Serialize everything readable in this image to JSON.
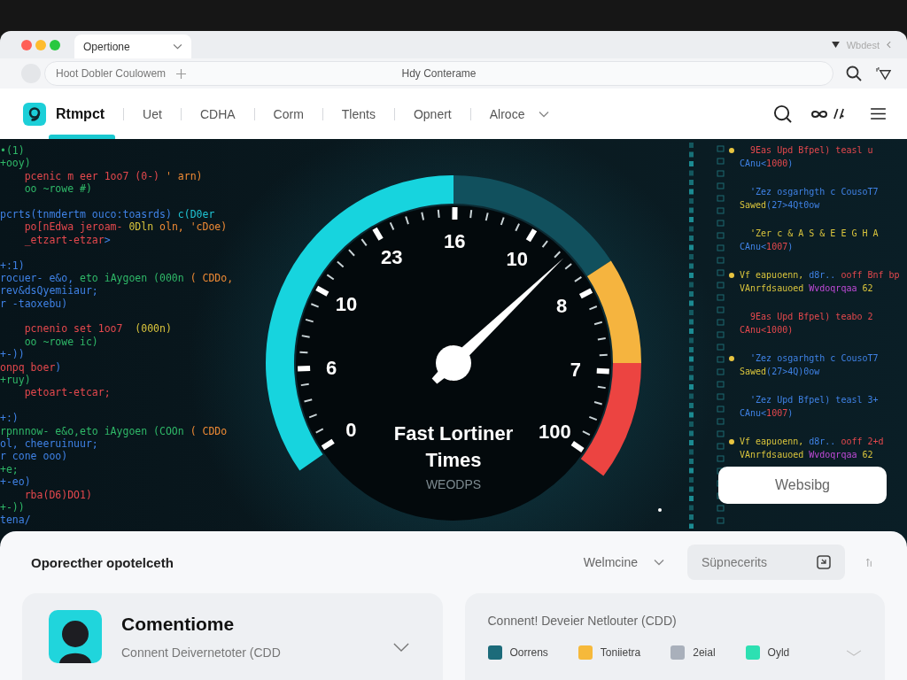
{
  "browser": {
    "tab": {
      "label": "Opertione",
      "selected": true
    },
    "tray_text": "Wbdest",
    "address_text": "Hoot Dobler Coulowem",
    "page_title": "Hdy Conterame"
  },
  "site_nav": {
    "brand": {
      "name": "Rtmpct",
      "active": true
    },
    "items": [
      {
        "label": "Uet",
        "kind": "link"
      },
      {
        "label": "CDHA",
        "kind": "link"
      },
      {
        "label": "Corm",
        "kind": "link"
      },
      {
        "label": "Tlents",
        "kind": "link"
      },
      {
        "label": "Opnert",
        "kind": "link"
      },
      {
        "label": "Alroce",
        "kind": "dropdown"
      }
    ]
  },
  "hero": {
    "left_code": [
      {
        "lines": [
          {
            "segments": [
              {
                "text": "•(1)",
                "kind": "string"
              }
            ]
          },
          {
            "segments": [
              {
                "text": "+ooy)",
                "kind": "string"
              }
            ]
          },
          {
            "segments": [
              {
                "text": "    pcenic m eer 1oo7 (0-)",
                "kind": "keyword"
              },
              {
                "text": " ' arn)",
                "kind": "operator"
              }
            ]
          },
          {
            "segments": [
              {
                "text": "    oo ~rowe #)",
                "kind": "string"
              }
            ]
          }
        ]
      },
      {
        "lines": [
          {
            "segments": [
              {
                "text": "pcrts(tnmdertm ouco:toasrds)",
                "kind": "name"
              },
              {
                "text": " c(D0er",
                "kind": "type"
              }
            ]
          },
          {
            "segments": [
              {
                "text": "    po[nEdwa jeroam-",
                "kind": "keyword"
              },
              {
                "text": " 0Dln",
                "kind": "number"
              },
              {
                "text": " oln, 'cDoe)",
                "kind": "operator"
              }
            ]
          },
          {
            "segments": [
              {
                "text": "    _etzart-etzar",
                "kind": "keyword"
              },
              {
                "text": ">",
                "kind": "name"
              }
            ]
          }
        ]
      },
      {
        "lines": [
          {
            "segments": [
              {
                "text": "+:1)",
                "kind": "name"
              }
            ]
          },
          {
            "segments": [
              {
                "text": "rocuer- e&o,",
                "kind": "name"
              },
              {
                "text": " eto iAygoen (000n",
                "kind": "string"
              },
              {
                "text": " ( CDDo,",
                "kind": "operator"
              }
            ]
          },
          {
            "segments": [
              {
                "text": "rev&dsQyemiiaur;",
                "kind": "name"
              }
            ]
          },
          {
            "segments": [
              {
                "text": "r -taoxebu)",
                "kind": "name"
              }
            ]
          }
        ]
      },
      {
        "lines": [
          {
            "segments": [
              {
                "text": "    pcnenio set 1oo7",
                "kind": "keyword"
              },
              {
                "text": "  (000n)",
                "kind": "number"
              }
            ]
          },
          {
            "segments": [
              {
                "text": "    oo ~rowe ic)",
                "kind": "string"
              }
            ]
          },
          {
            "segments": [
              {
                "text": "+-))",
                "kind": "name"
              }
            ]
          },
          {
            "segments": [
              {
                "text": "onpq boer",
                "kind": "keyword"
              },
              {
                "text": ")",
                "kind": "name"
              }
            ]
          },
          {
            "segments": [
              {
                "text": "+ruy)",
                "kind": "string"
              }
            ]
          },
          {
            "segments": [
              {
                "text": "    petoart-etcar;",
                "kind": "keyword"
              }
            ]
          }
        ]
      },
      {
        "lines": [
          {
            "segments": [
              {
                "text": "+:)",
                "kind": "name"
              }
            ]
          },
          {
            "segments": [
              {
                "text": "rpnnnow- e&o,eto iAygoen (COOn",
                "kind": "string"
              },
              {
                "text": " ( CDDo",
                "kind": "operator"
              }
            ]
          },
          {
            "segments": [
              {
                "text": "ol, cheeruinuur;",
                "kind": "name"
              }
            ]
          },
          {
            "segments": [
              {
                "text": "r cone ooo)",
                "kind": "name"
              }
            ]
          },
          {
            "segments": [
              {
                "text": "+e;",
                "kind": "string"
              }
            ]
          },
          {
            "segments": [
              {
                "text": "+-eo)",
                "kind": "name"
              }
            ]
          },
          {
            "segments": [
              {
                "text": "    rba(D6)DO1)",
                "kind": "keyword"
              }
            ]
          },
          {
            "segments": [
              {
                "text": "+-))",
                "kind": "string"
              }
            ]
          },
          {
            "segments": [
              {
                "text": "tena/",
                "kind": "name"
              }
            ]
          }
        ]
      }
    ],
    "gauge": {
      "labels": [
        "0",
        "6",
        "10",
        "23",
        "16",
        "10",
        "8",
        "7",
        "100"
      ],
      "level": 0.68,
      "title": "Fast Lortiner Times",
      "unit": "WEODPS"
    },
    "right_code": [
      {
        "breakpoint": true,
        "lines": [
          {
            "segments": [
              {
                "text": "  9Eas Upd Bfpel) teasl u",
                "kind": "keyword"
              }
            ]
          },
          {
            "segments": [
              {
                "text": "CAnu<",
                "kind": "name"
              },
              {
                "text": "1000",
                "kind": "keyword"
              },
              {
                "text": ")",
                "kind": "name"
              }
            ]
          }
        ]
      },
      {
        "breakpoint": false,
        "lines": [
          {
            "segments": [
              {
                "text": "  'Zez osgarhgth c CousoT7",
                "kind": "name"
              }
            ]
          },
          {
            "segments": [
              {
                "text": "Sawed",
                "kind": "number"
              },
              {
                "text": "(27>4Qt0ow",
                "kind": "name"
              }
            ]
          }
        ]
      },
      {
        "breakpoint": false,
        "lines": [
          {
            "segments": [
              {
                "text": "  'Zer c & A S & E E G H A",
                "kind": "number"
              }
            ]
          },
          {
            "segments": [
              {
                "text": "CAnu<",
                "kind": "name"
              },
              {
                "text": "1007",
                "kind": "keyword"
              },
              {
                "text": ")",
                "kind": "name"
              }
            ]
          }
        ]
      },
      {
        "breakpoint": true,
        "lines": [
          {
            "segments": [
              {
                "text": "Vf eapuoenn,",
                "kind": "number"
              },
              {
                "text": " d8r..",
                "kind": "name"
              },
              {
                "text": " ooff Bnf bp",
                "kind": "keyword"
              }
            ]
          },
          {
            "segments": [
              {
                "text": "VAnrfdsauoed",
                "kind": "number"
              },
              {
                "text": " Wvdoqrqaa",
                "kind": "magenta"
              },
              {
                "text": " 62",
                "kind": "number"
              }
            ]
          }
        ]
      },
      {
        "breakpoint": false,
        "lines": [
          {
            "segments": [
              {
                "text": "  9Eas Upd Bfpel) teabo 2",
                "kind": "keyword"
              }
            ]
          },
          {
            "segments": [
              {
                "text": "CAnu<1000)",
                "kind": "keyword"
              }
            ]
          }
        ]
      },
      {
        "breakpoint": true,
        "lines": [
          {
            "segments": [
              {
                "text": "  'Zez osgarhgth c CousoT7",
                "kind": "name"
              }
            ]
          },
          {
            "segments": [
              {
                "text": "Sawed",
                "kind": "number"
              },
              {
                "text": "(27>4Q)0ow",
                "kind": "name"
              }
            ]
          }
        ]
      },
      {
        "breakpoint": false,
        "lines": [
          {
            "segments": [
              {
                "text": "  'Zez Upd Bfpel) teasl 3+",
                "kind": "name"
              }
            ]
          },
          {
            "segments": [
              {
                "text": "CAnu<",
                "kind": "name"
              },
              {
                "text": "1007",
                "kind": "keyword"
              },
              {
                "text": ")",
                "kind": "name"
              }
            ]
          }
        ]
      },
      {
        "breakpoint": true,
        "lines": [
          {
            "segments": [
              {
                "text": "Vf eapuoenn,",
                "kind": "number"
              },
              {
                "text": " d8r..",
                "kind": "name"
              },
              {
                "text": " ooff 2+d",
                "kind": "keyword"
              }
            ]
          },
          {
            "segments": [
              {
                "text": "VAnrfdsauoed",
                "kind": "number"
              },
              {
                "text": " Wvdoqrqaa",
                "kind": "magenta"
              },
              {
                "text": " 62",
                "kind": "number"
              }
            ]
          }
        ]
      }
    ],
    "button": "Websibg"
  },
  "panel": {
    "title": "Oporecther opotelceth",
    "sort": {
      "label": "Welmcine"
    },
    "search": {
      "placeholder": "Süpnecerits"
    },
    "profile_card": {
      "title": "Comentiome",
      "subtitle": "Connent Deivernetoter (CDD"
    },
    "legend_card": {
      "title": "Connent! Deveier Netlouter (CDD)",
      "items": [
        {
          "label": "Oorrens",
          "color": "#1c6b7a"
        },
        {
          "label": "Toniietra",
          "color": "#f6b93b"
        },
        {
          "label": "2eial",
          "color": "#a9b0bb"
        },
        {
          "label": "Oyld",
          "color": "#2de0b2"
        }
      ]
    }
  }
}
